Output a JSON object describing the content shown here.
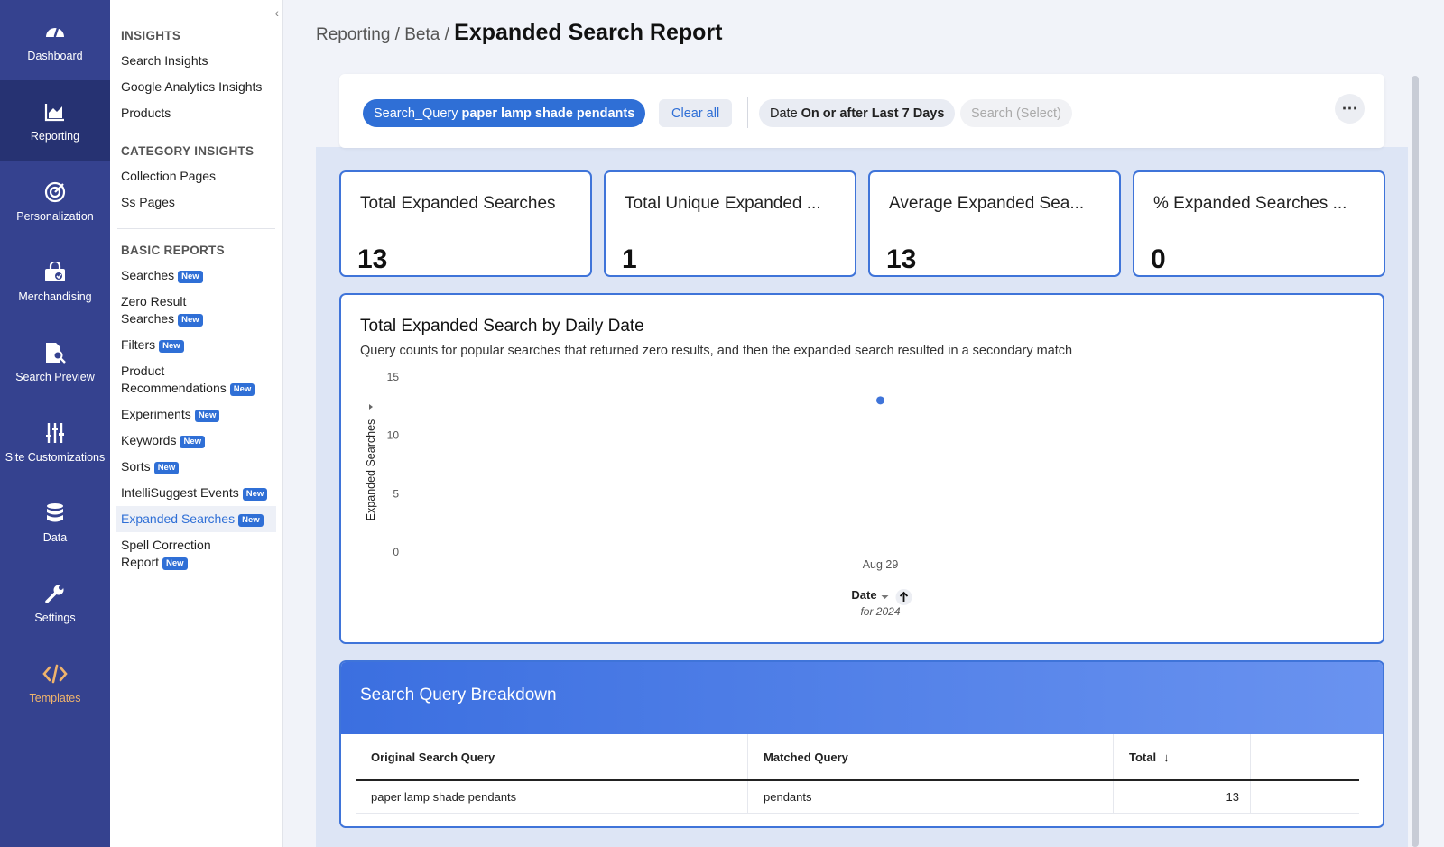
{
  "rail": {
    "items": [
      {
        "label": "Dashboard",
        "icon": "gauge-icon"
      },
      {
        "label": "Reporting",
        "icon": "chart-icon",
        "active": true
      },
      {
        "label": "Personalization",
        "icon": "target-icon"
      },
      {
        "label": "Merchandising",
        "icon": "shopping-bag-icon"
      },
      {
        "label": "Search Preview",
        "icon": "search-document-icon"
      },
      {
        "label": "Site Customizations",
        "icon": "sliders-icon"
      },
      {
        "label": "Data",
        "icon": "database-icon"
      },
      {
        "label": "Settings",
        "icon": "wrench-icon"
      },
      {
        "label": "Templates",
        "icon": "code-icon"
      }
    ]
  },
  "subnav": {
    "collapse_glyph": "‹",
    "new_badge": "New",
    "insights_heading": "INSIGHTS",
    "insights": [
      "Search Insights",
      "Google Analytics Insights",
      "Products"
    ],
    "category_heading": "CATEGORY INSIGHTS",
    "category": [
      "Collection Pages",
      "Ss Pages"
    ],
    "basic_heading": "BASIC REPORTS",
    "basic": [
      {
        "l1": "Searches",
        "l2": ""
      },
      {
        "l1": "Zero Result",
        "l2": "Searches"
      },
      {
        "l1": "Filters",
        "l2": ""
      },
      {
        "l1": "Product",
        "l2": "Recommendations"
      },
      {
        "l1": "Experiments",
        "l2": ""
      },
      {
        "l1": "Keywords",
        "l2": ""
      },
      {
        "l1": "Sorts",
        "l2": ""
      },
      {
        "l1": "IntelliSuggest Events",
        "l2": ""
      },
      {
        "l1": "Expanded Searches",
        "l2": ""
      },
      {
        "l1": "Spell Correction",
        "l2": "Report"
      }
    ]
  },
  "header": {
    "crumb1": "Reporting",
    "sep": " / ",
    "crumb2": "Beta",
    "title": "Expanded Search Report"
  },
  "filters": {
    "query_key": "Search_Query",
    "query_value": "paper lamp shade pendants",
    "clear_all": "Clear all",
    "date_key": "Date",
    "date_value": "On or after Last 7 Days",
    "search_key": "Search",
    "search_value": "(Select)",
    "more": "⋯"
  },
  "kpis": [
    {
      "title": "Total Expanded Searches",
      "value": "13"
    },
    {
      "title": "Total Unique Expanded ...",
      "value": "1"
    },
    {
      "title": "Average Expanded Sea...",
      "value": "13"
    },
    {
      "title": "% Expanded Searches ...",
      "value": "0"
    }
  ],
  "chart": {
    "title": "Total Expanded Search by Daily Date",
    "subtitle": "Query counts for popular searches that returned zero results, and then the expanded search resulted in a secondary match"
  },
  "chart_data": {
    "type": "scatter",
    "x": [
      "Aug 29"
    ],
    "y": [
      13
    ],
    "ylabel": "Expanded Searches",
    "xlabel": "Date",
    "x_caption": "for 2024",
    "yticks": [
      0,
      5,
      10,
      15
    ],
    "ylim": [
      0,
      15
    ],
    "point_color": "#3f74d9",
    "grid": false
  },
  "table": {
    "title": "Search Query Breakdown",
    "columns": [
      "Original Search Query",
      "Matched Query",
      "Total",
      ""
    ],
    "sort_glyph": "↓",
    "rows": [
      {
        "original": "paper lamp shade pendants",
        "matched": "pendants",
        "total": "13"
      }
    ]
  },
  "colors": {
    "rail": "#35428f",
    "accent": "#2f6fd6",
    "card_border": "#3f74d9"
  }
}
